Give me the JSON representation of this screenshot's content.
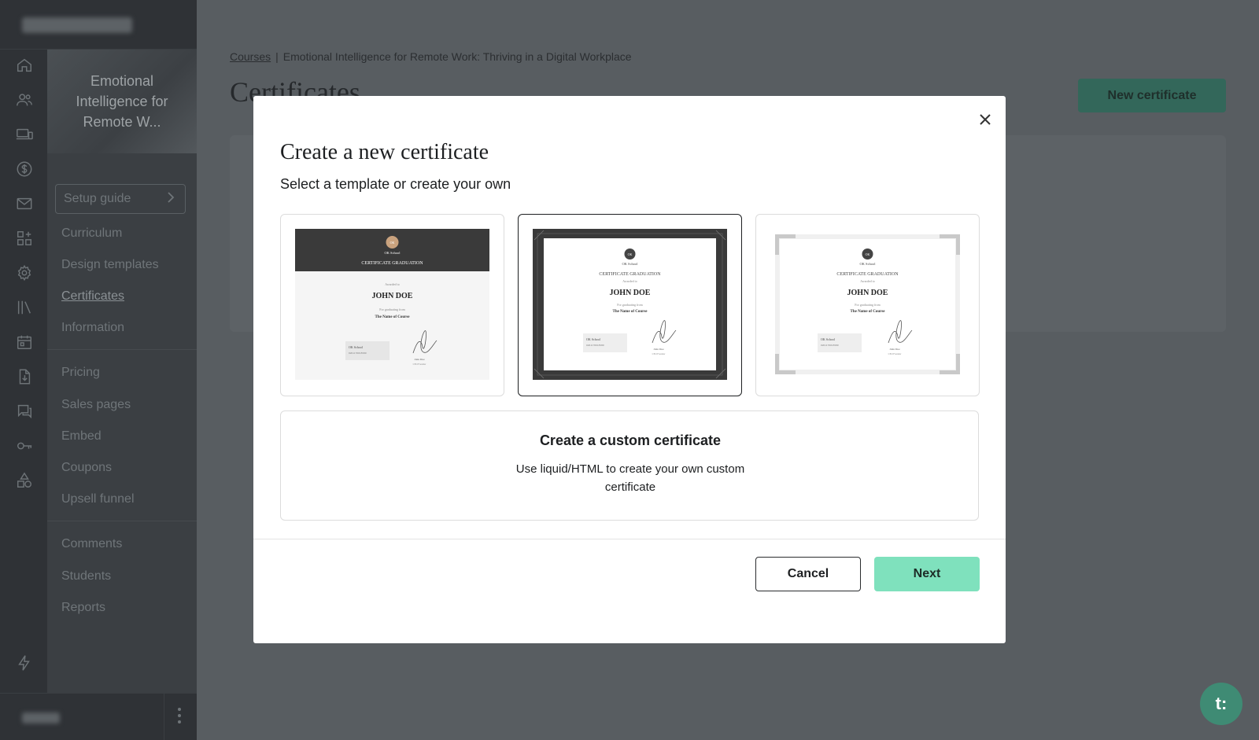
{
  "course_sidebar": {
    "course_title": "Emotional Intelligence for Remote W...",
    "setup_guide": "Setup guide",
    "group1": [
      "Curriculum",
      "Design templates",
      "Certificates",
      "Information"
    ],
    "group2": [
      "Pricing",
      "Sales pages",
      "Embed",
      "Coupons",
      "Upsell funnel"
    ],
    "group3": [
      "Comments",
      "Students",
      "Reports"
    ],
    "active": "Certificates"
  },
  "rail_icons": [
    "home-icon",
    "users-icon",
    "devices-icon",
    "dollar-icon",
    "mail-icon",
    "apps-icon",
    "gear-icon",
    "library-icon",
    "calendar-icon",
    "download-doc-icon",
    "chat-icon",
    "key-icon",
    "shapes-icon",
    "lightning-icon"
  ],
  "main": {
    "breadcrumb_link": "Courses",
    "breadcrumb_sep": "|",
    "breadcrumb_current": "Emotional Intelligence for Remote Work: Thriving in a Digital Workplace",
    "page_title": "Certificates",
    "new_certificate": "New certificate"
  },
  "modal": {
    "title": "Create a new certificate",
    "subtitle": "Select a template or create your own",
    "templates": [
      {
        "school": "OK School",
        "heading": "CERTIFICATE GRADUATION",
        "awarded": "Awarded to",
        "name": "JOHN DOE",
        "for": "For graduating from",
        "course": "The Name of Course",
        "badge": "OK",
        "sig_name": "John Doe",
        "sig_role": "CEO Founder",
        "box_label": "OK School",
        "box_num": "0261170018580"
      },
      {
        "school": "OK School",
        "heading": "CERTIFICATE GRADUATION",
        "awarded": "Awarded to",
        "name": "JOHN DOE",
        "for": "For graduating from",
        "course": "The Name of Course",
        "badge": "OK",
        "sig_name": "John Doe",
        "sig_role": "CEO Founder",
        "box_label": "OK School",
        "box_num": "0261170018580"
      },
      {
        "school": "OK School",
        "heading": "CERTIFICATE GRADUATION",
        "awarded": "Awarded to",
        "name": "JOHN DOE",
        "for": "For graduating from",
        "course": "The Name of Course",
        "badge": "OK",
        "sig_name": "John Doe",
        "sig_role": "CEO Founder",
        "box_label": "OK School",
        "box_num": "0261170018580"
      }
    ],
    "selected_template": 1,
    "custom_title": "Create a custom certificate",
    "custom_desc": "Use liquid/HTML to create your own custom certificate",
    "cancel": "Cancel",
    "next": "Next"
  },
  "chat_label": "t:",
  "colors": {
    "accent": "#7fe1bd",
    "brand_dark": "#33675a",
    "chat": "#3f8b74"
  }
}
